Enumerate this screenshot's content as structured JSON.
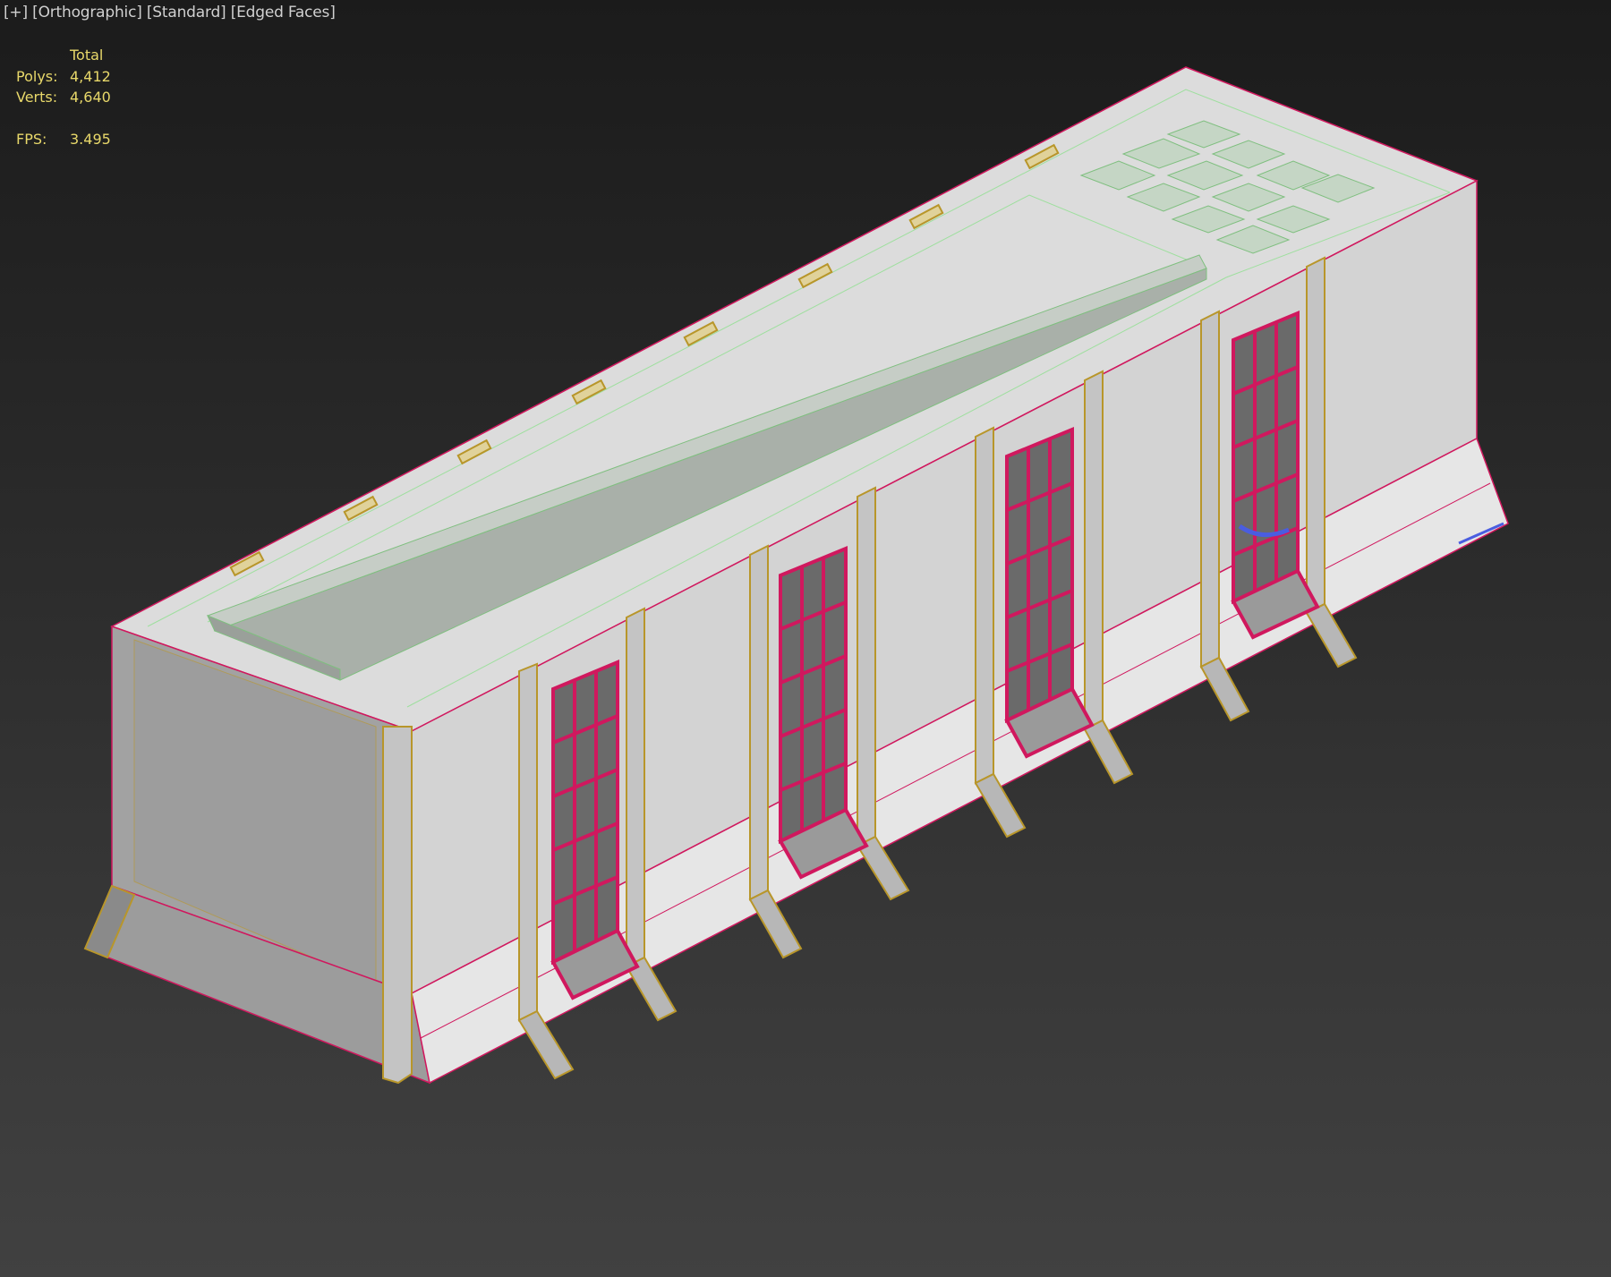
{
  "viewport": {
    "menu_label": "[+]",
    "view_label": "[Orthographic]",
    "shading_label": "[Standard]",
    "edges_label": "[Edged Faces]"
  },
  "stats": {
    "header": "Total",
    "polys_label": "Polys:",
    "polys_value": "4,412",
    "verts_label": "Verts:",
    "verts_value": "4,640",
    "fps_label": "FPS:",
    "fps_value": "3.495"
  },
  "colors": {
    "background_top": "#1b1b1b",
    "background_bottom": "#414141",
    "stats_text": "#e8d86a",
    "selection_edges": "#d0185e",
    "wire_green": "#8fe08f",
    "wire_gold": "#b8962a"
  }
}
